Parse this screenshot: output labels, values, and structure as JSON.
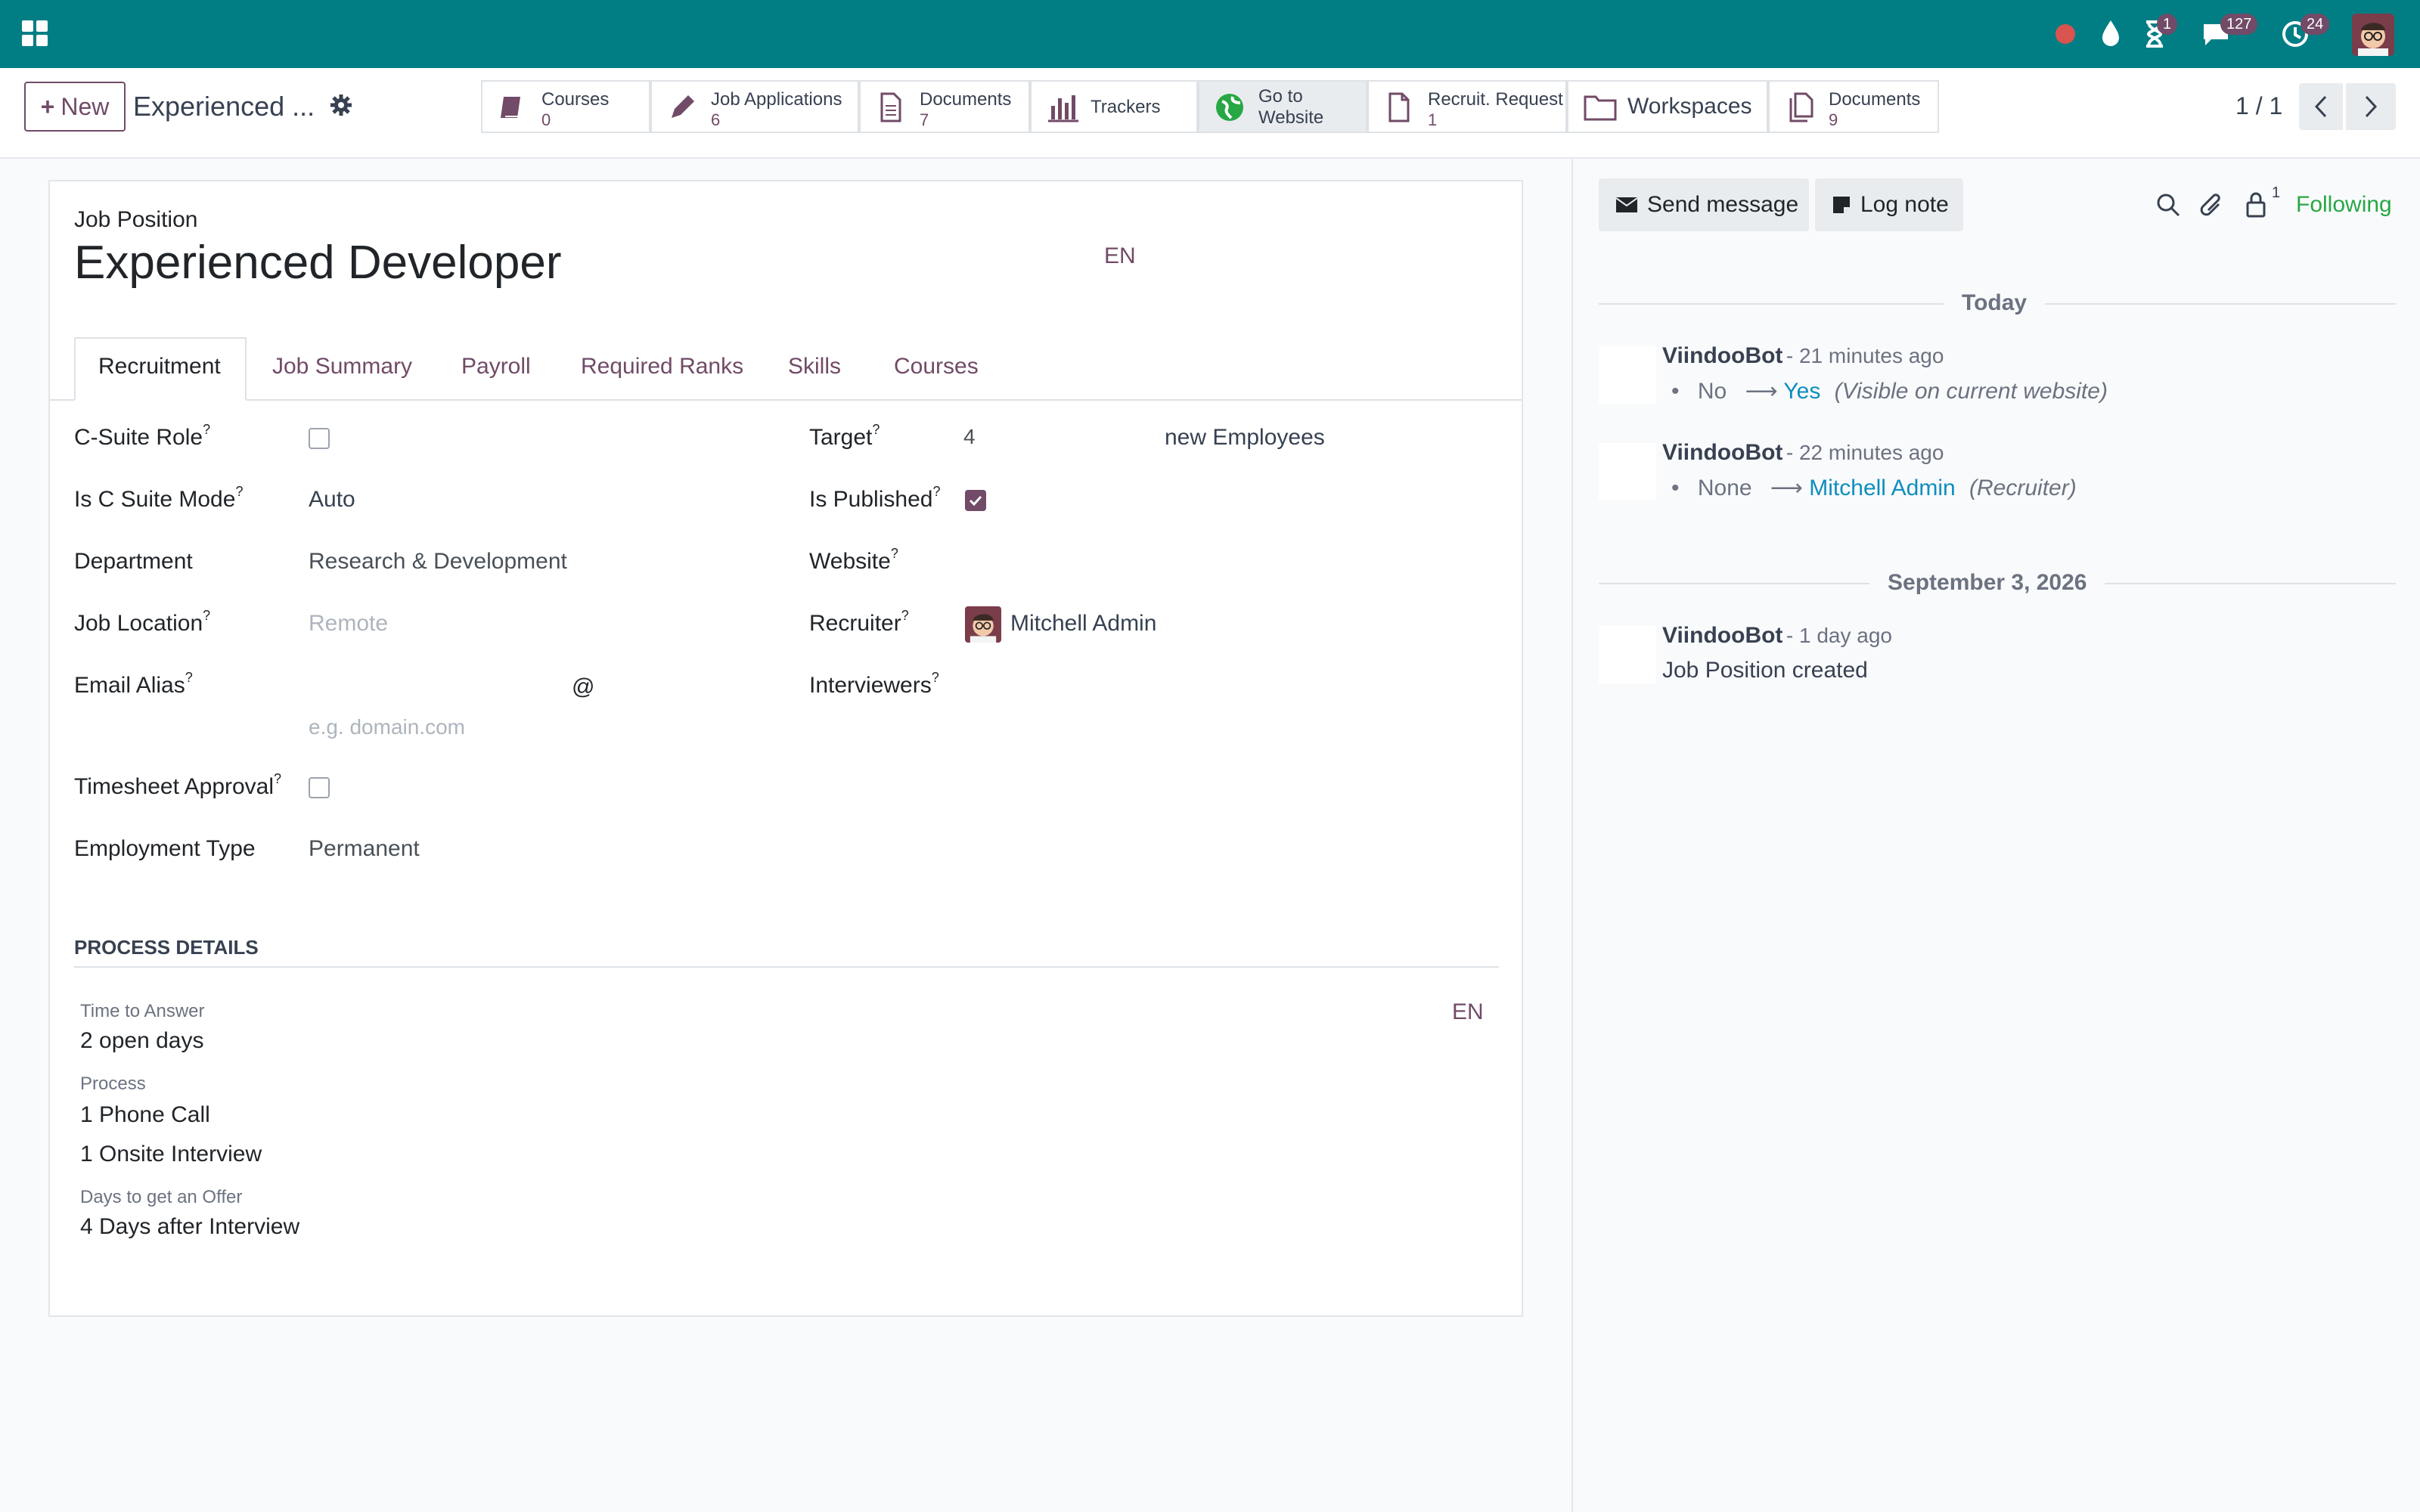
{
  "navbar": {
    "badges": {
      "activity": "1",
      "messages": "127",
      "clock": "24"
    }
  },
  "control": {
    "new_label": "New",
    "record_title": "Experienced ...",
    "pager": "1 / 1",
    "smart_buttons": [
      {
        "label": "Courses",
        "count": "0"
      },
      {
        "label": "Job Applications",
        "count": "6"
      },
      {
        "label": "Documents",
        "count": "7"
      },
      {
        "label": "Trackers"
      },
      {
        "label": "Go to",
        "label2": "Website"
      },
      {
        "label": "Recruit. Request",
        "count": "1"
      },
      {
        "label": "Workspaces"
      },
      {
        "label": "Documents",
        "count": "9"
      }
    ]
  },
  "form": {
    "header_label": "Job Position",
    "title": "Experienced Developer",
    "lang": "EN",
    "tabs": [
      "Recruitment",
      "Job Summary",
      "Payroll",
      "Required Ranks",
      "Skills",
      "Courses"
    ],
    "left": {
      "c_suite_role": "C-Suite Role",
      "is_c_suite_mode": "Is C Suite Mode",
      "is_c_suite_mode_val": "Auto",
      "department": "Department",
      "department_val": "Research & Development",
      "job_location": "Job Location",
      "job_location_ph": "Remote",
      "email_alias": "Email Alias",
      "email_at": "@",
      "email_domain_ph": "e.g. domain.com",
      "timesheet_approval": "Timesheet Approval",
      "employment_type": "Employment Type",
      "employment_type_val": "Permanent"
    },
    "right": {
      "target": "Target",
      "target_val": "4",
      "target_unit": "new Employees",
      "is_published": "Is Published",
      "website": "Website",
      "recruiter": "Recruiter",
      "recruiter_val": "Mitchell Admin",
      "interviewers": "Interviewers"
    },
    "process": {
      "heading": "PROCESS DETAILS",
      "lang": "EN",
      "time_label": "Time to Answer",
      "time_val": "2 open days",
      "process_label": "Process",
      "process_1": "1 Phone Call",
      "process_2": "1 Onsite Interview",
      "offer_label": "Days to get an Offer",
      "offer_val": "4 Days after Interview"
    },
    "help_mark": "?"
  },
  "chatter": {
    "send_message": "Send message",
    "log_note": "Log note",
    "followers_count": "1",
    "following": "Following",
    "today": "Today",
    "date2": "September 3, 2026",
    "messages": [
      {
        "author": "ViindooBot",
        "time": "- 21 minutes ago",
        "old": "No",
        "new": "Yes",
        "field": "(Visible on current website)"
      },
      {
        "author": "ViindooBot",
        "time": "- 22 minutes ago",
        "old": "None",
        "new": "Mitchell Admin",
        "field": "(Recruiter)"
      },
      {
        "author": "ViindooBot",
        "time": "- 1 day ago",
        "body": "Job Position created"
      }
    ]
  }
}
